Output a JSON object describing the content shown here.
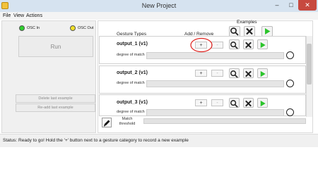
{
  "window": {
    "title": "New Project",
    "controls": [
      "–",
      "□",
      "✕"
    ]
  },
  "menu": [
    "File",
    "View",
    "Actions"
  ],
  "left_panel": {
    "osc_in_label": "OSC In",
    "osc_out_label": "OSC Out",
    "run_label": "Run",
    "delete_label": "Delete last example",
    "readd_label": "Re-add last example"
  },
  "headers": {
    "gesture_types": "Gesture Types",
    "add_remove": "Add / Remove",
    "examples": "Examples"
  },
  "gestures": [
    {
      "name": "output_1 (v1)",
      "match_label": "degree of match",
      "plus": "+",
      "minus": "-"
    },
    {
      "name": "output_2 (v1)",
      "match_label": "degree of match",
      "plus": "+",
      "minus": "-"
    },
    {
      "name": "output_3 (v1)",
      "match_label": "degree of match",
      "plus": "+",
      "minus": "-"
    }
  ],
  "footer": {
    "match_threshold_line1": "Match",
    "match_threshold_line2": "threshold"
  },
  "status": "Status: Ready to go! Hold the '+' button next to a gesture category to record a new example",
  "colors": {
    "osc_in": "#2fd12f",
    "osc_out": "#f0e028",
    "play": "#2bc42b",
    "annotation": "#e0231f"
  },
  "icons": [
    "search-icon",
    "close-x-icon",
    "play-icon",
    "pencil-icon"
  ]
}
